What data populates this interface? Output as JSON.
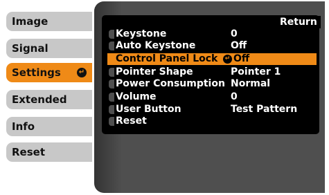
{
  "tabs": [
    {
      "label": "Image"
    },
    {
      "label": "Signal"
    },
    {
      "label": "Settings"
    },
    {
      "label": "Extended"
    },
    {
      "label": "Info"
    },
    {
      "label": "Reset"
    }
  ],
  "return_label": "Return",
  "rows": [
    {
      "label": "Keystone",
      "value": "0"
    },
    {
      "label": "Auto Keystone",
      "value": "Off"
    },
    {
      "label": "Control Panel Lock",
      "value": "Off"
    },
    {
      "label": "Pointer Shape",
      "value": "Pointer 1"
    },
    {
      "label": "Power Consumption",
      "value": "Normal"
    },
    {
      "label": "Volume",
      "value": "0"
    },
    {
      "label": "User Button",
      "value": "Test Pattern"
    },
    {
      "label": "Reset",
      "value": ""
    }
  ],
  "colors": {
    "highlight": "#ef8a17",
    "tab": "#c8c8c8",
    "panel": "#4f4f4f"
  }
}
